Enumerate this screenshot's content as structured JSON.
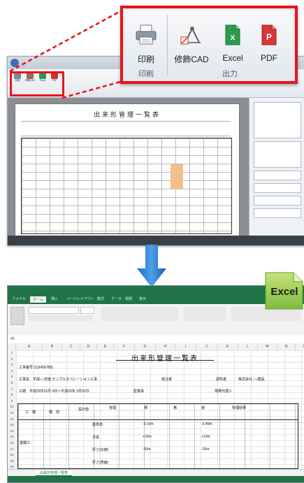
{
  "callout": {
    "print_label": "印刷",
    "cad_label": "修飾CAD",
    "excel_label": "Excel",
    "pdf_label": "PDF",
    "group_print": "印刷",
    "group_output": "出力"
  },
  "top_window": {
    "sheet_title": "出来形管理一覧表",
    "mini_buttons": [
      "印刷",
      "修飾CAD",
      "Excel",
      "PDF"
    ]
  },
  "badge": {
    "label": "Excel"
  },
  "excel": {
    "tabs": [
      "ファイル",
      "ホーム",
      "挿入",
      "ページレイアウト",
      "数式",
      "データ",
      "校閲",
      "表示"
    ],
    "name_box": "A1",
    "sheet_title": "出来形管理一覧表",
    "sheet_tab": "出来形管理一覧表",
    "columns": [
      "A",
      "B",
      "C",
      "D",
      "E",
      "F",
      "G",
      "H",
      "I",
      "J",
      "K",
      "L",
      "M",
      "N",
      "O"
    ],
    "rows": [
      "1",
      "2",
      "3",
      "4",
      "5",
      "6",
      "7",
      "8",
      "9",
      "10",
      "11",
      "12",
      "13",
      "14",
      "15",
      "16",
      "17",
      "18",
      "19",
      "20"
    ],
    "r3": "工事番号 (2)3456789)",
    "r5a": "工事名　平成○○年度 サンプルオペレーション工事",
    "r5b": "受注者",
    "r5c": "請負者",
    "r5d": "株式会社 ○○建設",
    "r7a": "工期　平成25年10月 4日～平成26年 3月31日",
    "r7b": "監督員",
    "r7c": "現場代理人",
    "hdr_kou": "工　種",
    "hdr_shu": "種　別",
    "hdr_sekkei": "設計値",
    "hdr_kanri": "管理",
    "hdr_ki": "規",
    "hdr_kaku": "格",
    "hdr_ti": "値",
    "hdr_result": "管理結果",
    "c_kiso": "基礎工",
    "c_kihon": "基準高",
    "c_haba": "法長",
    "c_atsu": "厚さ(伝統)",
    "c_atsu2": "厚さ(表面)",
    "v1": "-3.10m",
    "v2": "-3.45m",
    "v3": "+10m",
    "v4": "+10m",
    "v5": "-50m",
    "v6": "-10m"
  }
}
